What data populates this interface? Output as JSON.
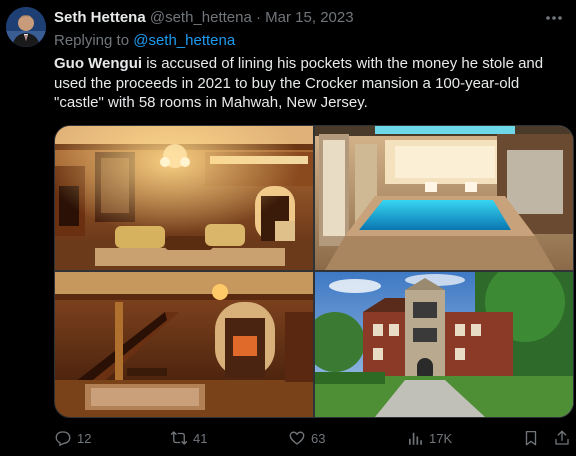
{
  "tweet": {
    "author_name": "Seth Hettena",
    "author_handle": "@seth_hettena",
    "separator": "·",
    "date": "Mar 15, 2023",
    "reply_prefix": "Replying to",
    "reply_to": "@seth_hettena",
    "text_bold": "Guo Wengui",
    "text_rest": " is accused of lining his pockets with the money he stole and used the proceeds in 2021 to buy the Crocker mansion a 100-year-old \"castle\" with 58 rooms in Mahwah, New Jersey."
  },
  "actions": {
    "replies": "12",
    "reposts": "41",
    "likes": "63",
    "views": "17K"
  },
  "media": [
    {
      "description": "ornate wood-paneled living room"
    },
    {
      "description": "indoor swimming pool"
    },
    {
      "description": "wood-paneled entry hall with staircase"
    },
    {
      "description": "exterior of the brick mansion"
    }
  ],
  "colors": {
    "background": "#000000",
    "text": "#e7e9ea",
    "secondary": "#71767b",
    "link": "#1d9bf0"
  }
}
